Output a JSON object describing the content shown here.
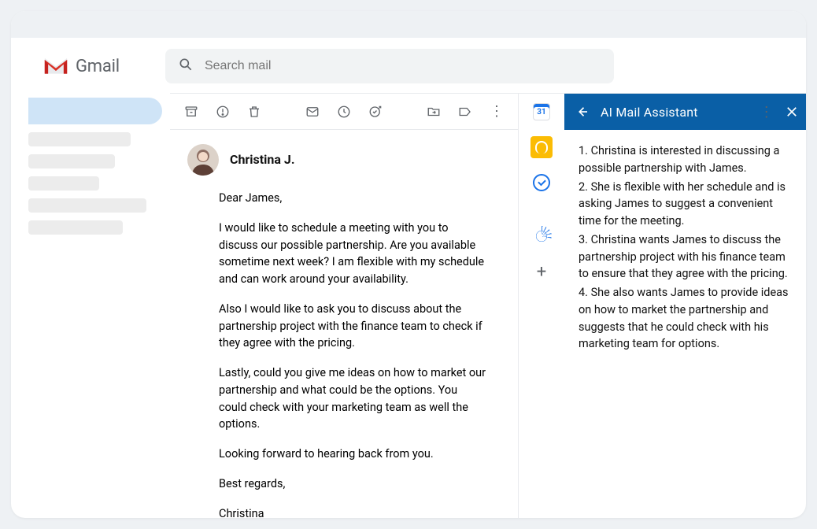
{
  "header": {
    "product_name": "Gmail",
    "search_placeholder": "Search mail"
  },
  "sidebar": {
    "items": [
      {
        "active": true
      },
      {
        "active": false
      },
      {
        "active": false
      },
      {
        "active": false
      },
      {
        "active": false
      },
      {
        "active": false
      }
    ]
  },
  "toolbar": {
    "icons": [
      "archive-icon",
      "report-spam-icon",
      "delete-icon",
      "mark-unread-icon",
      "snooze-icon",
      "add-to-tasks-icon",
      "move-to-icon",
      "labels-icon",
      "more-icon"
    ]
  },
  "rail": {
    "calendar_day": "31"
  },
  "email": {
    "sender_name": "Christina J.",
    "greeting": "Dear James,",
    "p1": "I would like to schedule a meeting with you to discuss our possible partnership. Are you available sometime next week? I am flexible with my schedule and can work around your availability.",
    "p2": "Also I would like to ask you to discuss about the partnership project with the finance team to check if they agree with the pricing.",
    "p3": "Lastly, could you give me ideas on how to market our partnership and what could be the options. You could check with your marketing team as well the options.",
    "p4": "Looking forward to hearing back from you.",
    "closing": "Best regards,",
    "signature": "Christina"
  },
  "assistant": {
    "title": "AI Mail Assistant",
    "summary": {
      "l1": "1. Christina is interested in discussing a possible partnership with James.",
      "l2": "2. She is flexible with her schedule and is asking James to suggest a convenient time for the meeting.",
      "l3": "3. Christina wants James to discuss the partnership project with his finance team to ensure that they agree with the pricing.",
      "l4": "4. She also wants James to provide ideas on how to market the partnership and suggests that he could check with his marketing team for options."
    }
  }
}
